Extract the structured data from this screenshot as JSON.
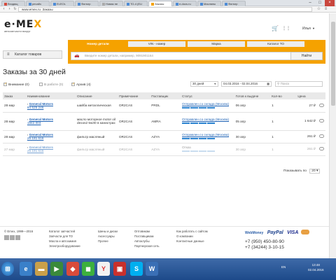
{
  "browser": {
    "tabs": [
      {
        "label": "Входящ"
      },
      {
        "label": "ресайз"
      },
      {
        "label": "ELEOL"
      },
      {
        "label": "Фильтр"
      },
      {
        "label": "Новая пе"
      },
      {
        "label": "ТО-4 (ELI"
      },
      {
        "label": "Заказы"
      },
      {
        "label": "e-docs.ru"
      },
      {
        "label": "Масляны"
      },
      {
        "label": "Фильтр"
      }
    ],
    "url": "www.emex.ru",
    "page_title": "Заказы"
  },
  "site": {
    "logo_text_1": "e",
    "logo_text_2": "M",
    "logo_text_3": "E",
    "logo_x": "X",
    "logo_subtitle": "автозапчасти вокруг",
    "user_name": "Илья"
  },
  "search": {
    "tabs": [
      "Номер детали",
      "VIN - номер",
      "Марка",
      "Каталог ТО"
    ],
    "active_tab": 0,
    "placeholder": "Введите номер детали, например, 9091901164",
    "button_label": "Найти"
  },
  "catalog_button": "Каталог товаров",
  "orders": {
    "title": "Заказы за 30 дней",
    "filter_attention": "Внимание (0)",
    "filter_inwork": "В работе (0)",
    "filter_archive": "Архив (4)",
    "period_select": "30 дней",
    "date_range": "04.03.2016 - 02.04.2016",
    "search_placeholder": "Поиск",
    "columns": [
      "Заказ",
      "Наименование",
      "Описание",
      "Примечание",
      "Поставщик",
      "Статус",
      "Готов к выдаче",
      "Кол-во",
      "Цена"
    ],
    "rows": [
      {
        "date": "28 мар",
        "brand": "General Motors",
        "article": "94 525 246",
        "description": "шайба металлическая",
        "note": "DR2CAS",
        "supplier": "PRDL",
        "status": "Отправлен со склада (Москва)",
        "progress": 4,
        "ready": "06 апр",
        "qty": "1",
        "price": "27 ₽",
        "inactive": false
      },
      {
        "date": "28 мар",
        "brand": "General Motors",
        "article": "1942 003",
        "description": "масло моторное motor oil dexos2 5w30 в канистрах",
        "note": "DR2CAS",
        "supplier": "AMRA",
        "status": "Отправлен со склада (Москва)",
        "progress": 4,
        "ready": "05 апр",
        "qty": "1",
        "price": "1 642 ₽",
        "inactive": false
      },
      {
        "date": "28 мар",
        "brand": "General Motors",
        "article": "25 181 616",
        "description": "фильтр масляный",
        "note": "DR2CAS",
        "supplier": "AZYA",
        "status": "Отправлен со склада (Москва)",
        "progress": 4,
        "ready": "30 апр",
        "qty": "1",
        "price": "261 ₽",
        "inactive": false
      },
      {
        "date": "27 мар",
        "brand": "General Motors",
        "article": "25 181 616",
        "description": "фильтр масляный",
        "note": "DR2CAS",
        "supplier": "AZYA",
        "status": "Отказ",
        "progress": 4,
        "ready": "30 апр",
        "qty": "1",
        "price": "261 ₽",
        "inactive": true
      }
    ],
    "per_page_label": "Показывать по",
    "per_page_value": "20"
  },
  "footer": {
    "copyright": "© Emex, 1999—2016",
    "col1": [
      "Каталог запчастей",
      "Запчасти для ТО",
      "Масла и автохимия",
      "Электрооборудование"
    ],
    "col2": [
      "Шины и диски",
      "Аксессуары",
      "Прочее"
    ],
    "col3": [
      "Оптовикам",
      "Поставщикам",
      "Автоклубы",
      "Партнерская сеть"
    ],
    "col4": [
      "Как работать с сайтом",
      "О компании",
      "Контактные данные"
    ],
    "phone1": "+7 (950) 450-80-90",
    "phone2": "+7 (34244) 3-10-15",
    "payments": [
      "WebMoney",
      "PayPal",
      "VISA"
    ]
  },
  "taskbar": {
    "lang": "EN",
    "time": "13:48",
    "date": "02.04.2016"
  }
}
